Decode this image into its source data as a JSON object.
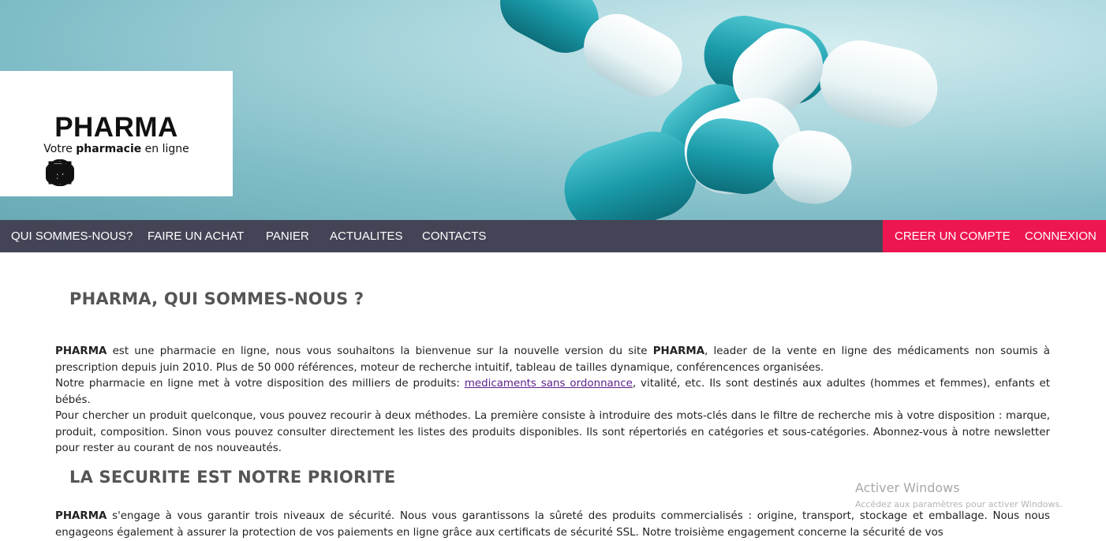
{
  "brand": {
    "title": "PHARMA",
    "tagline_pre": "Votre ",
    "tagline_bold": "pharmacie",
    "tagline_post": " en ligne",
    "social_icons": [
      "youtube-icon",
      "instagram-icon",
      "facebook-icon",
      "twitter-icon"
    ]
  },
  "nav": {
    "items": [
      "QUI SOMMES-NOUS?",
      "FAIRE UN ACHAT",
      "PANIER",
      "ACTUALITES",
      "CONTACTS"
    ],
    "create_account": "CREER UN COMPTE",
    "login": "CONNEXION"
  },
  "section1": {
    "heading": "PHARMA, QUI SOMMES-NOUS ?",
    "p1_bold": "PHARMA",
    "p1_text_a": " est une pharmacie en ligne, nous vous souhaitons la bienvenue sur la nouvelle version du site ",
    "p1_bold2": "PHARMA",
    "p1_text_b": ", leader de la vente en ligne des médicaments non soumis à prescription depuis juin 2010. Plus de 50 000 références, moteur de recherche intuitif, tableau de tailles dynamique, conférencences organisées.",
    "p2_text_a": "Notre pharmacie en ligne met à votre disposition des milliers de produits: ",
    "p2_link": "medicaments sans ordonnance",
    "p2_text_b": ", vitalité, etc. Ils sont destinés aux adultes (hommes et femmes), enfants et bébés.",
    "p3_text": "Pour chercher un produit quelconque, vous pouvez recourir à deux méthodes. La première consiste à introduire des mots-clés dans le filtre de recherche mis à votre disposition : marque, produit, composition. Sinon vous pouvez consulter directement les listes des produits disponibles. Ils sont répertoriés en catégories et sous-catégories. Abonnez-vous à notre newsletter pour rester au courant de nos nouveautés."
  },
  "section2": {
    "heading": "LA SECURITE EST NOTRE PRIORITE",
    "p_bold": "PHARMA",
    "p_text": " s'engage à vous garantir trois niveaux de sécurité. Nous vous garantissons la sûreté des produits commercialisés : origine, transport, stockage et emballage. Nous nous engageons également à assurer la protection de vos paiements en ligne grâce aux certificats de sécurité SSL. Notre troisième engagement concerne la sécurité de vos"
  },
  "watermark": {
    "line1": "Activer Windows",
    "line2": "Accédez aux paramètres pour activer Windows."
  },
  "colors": {
    "nav_bg": "#434556",
    "cta_bg": "#ee1650",
    "heading": "#555555",
    "capsule_teal": "#1fa3b0"
  }
}
